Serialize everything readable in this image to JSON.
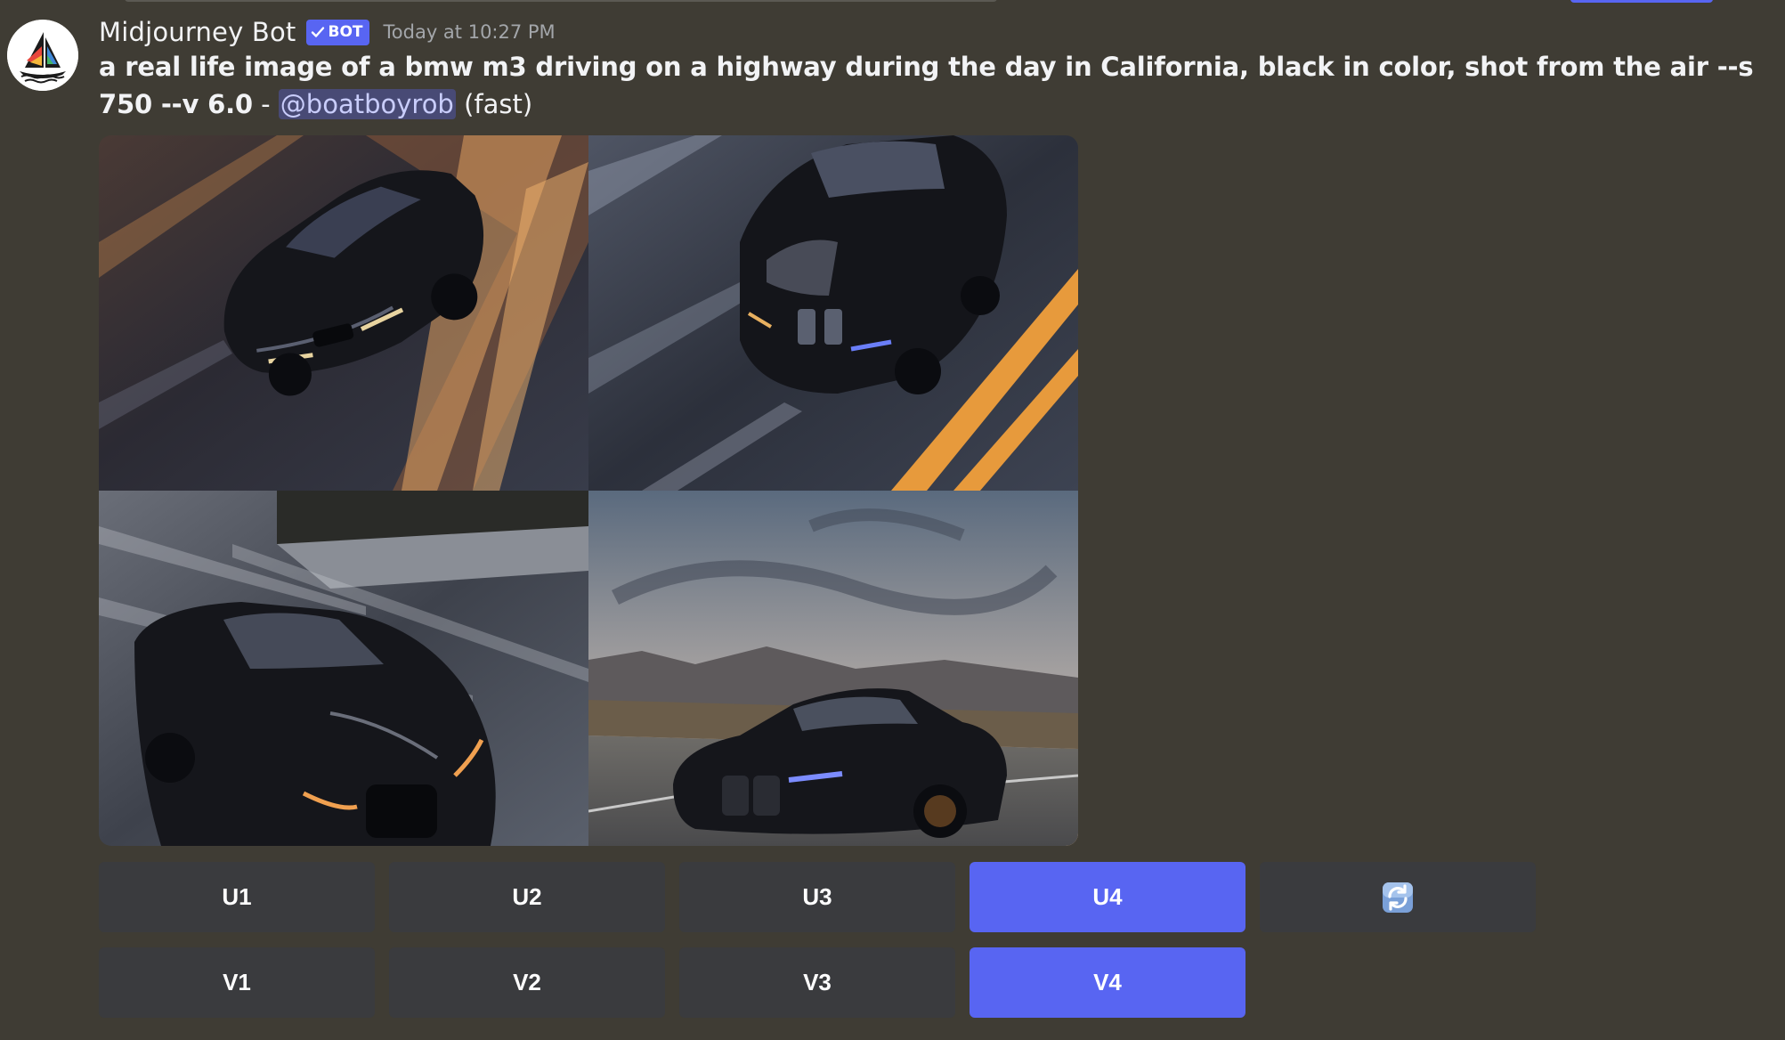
{
  "message": {
    "author": "Midjourney Bot",
    "badge": "BOT",
    "timestamp": "Today at 10:27 PM",
    "prompt": "a real life image of a bmw m3 driving on a highway during the day in California, black in color, shot from the air --s 750 --v 6.0",
    "dash": "-",
    "mention": "@boatboyrob",
    "mode": "(fast)"
  },
  "images": [
    {
      "subject": "black bmw on highway with golden light streaks"
    },
    {
      "subject": "black bmw top-down on wet road with orange lane lines"
    },
    {
      "subject": "black bmw on grey highway, front view"
    },
    {
      "subject": "black bmw on desert highway at sunset with mountains"
    }
  ],
  "buttons": {
    "upscale": [
      {
        "label": "U1",
        "active": false
      },
      {
        "label": "U2",
        "active": false
      },
      {
        "label": "U3",
        "active": false
      },
      {
        "label": "U4",
        "active": true
      }
    ],
    "reroll_icon": "reroll-icon",
    "variation": [
      {
        "label": "V1",
        "active": false
      },
      {
        "label": "V2",
        "active": false
      },
      {
        "label": "V3",
        "active": false
      },
      {
        "label": "V4",
        "active": true
      }
    ]
  },
  "colors": {
    "background": "#3f3c34",
    "accent": "#5865f2",
    "button": "#3a3b3e"
  }
}
